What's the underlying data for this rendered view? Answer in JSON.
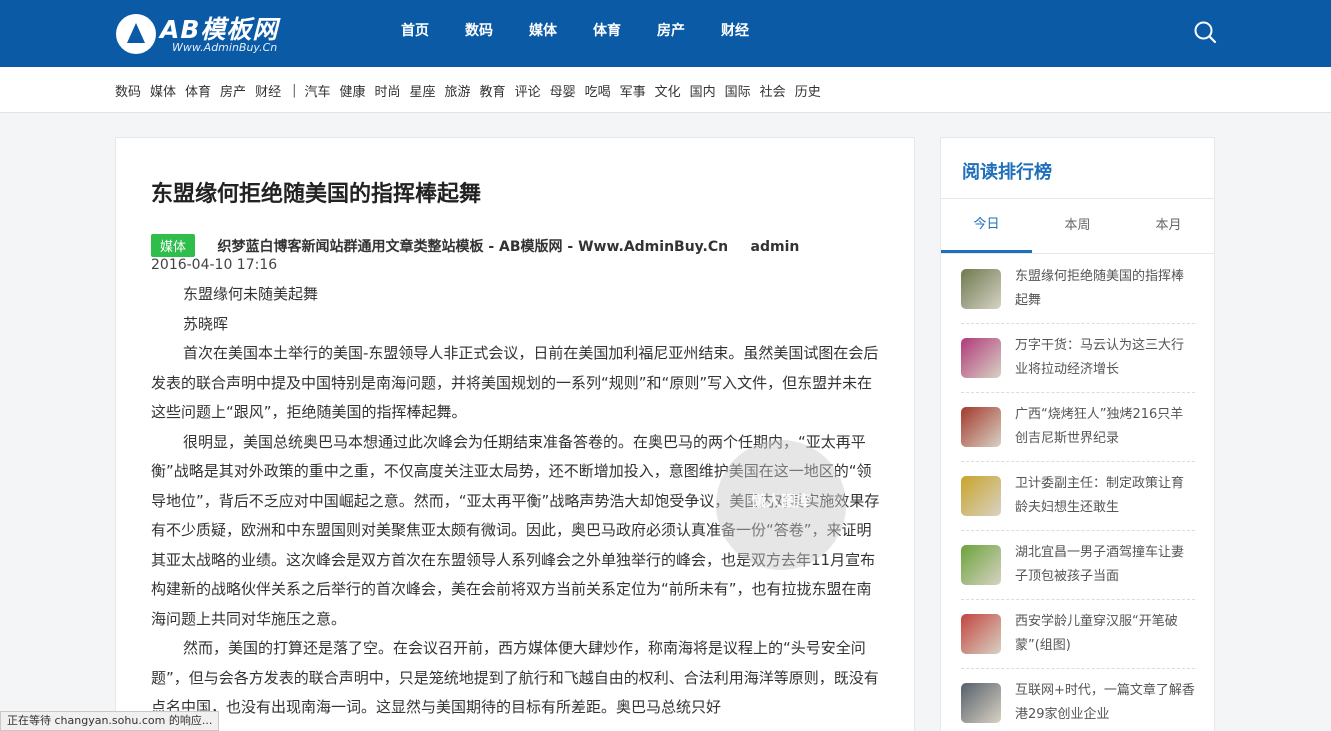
{
  "header": {
    "logo_text": "AB模板网",
    "logo_sub": "Www.AdminBuy.Cn",
    "nav": [
      "首页",
      "数码",
      "媒体",
      "体育",
      "房产",
      "财经"
    ]
  },
  "subnav": {
    "group1": [
      "数码",
      "媒体",
      "体育",
      "房产",
      "财经"
    ],
    "separator": "|",
    "group2": [
      "汽车",
      "健康",
      "时尚",
      "星座",
      "旅游",
      "教育",
      "评论",
      "母婴",
      "吃喝",
      "军事",
      "文化",
      "国内",
      "国际",
      "社会",
      "历史"
    ]
  },
  "article": {
    "title": "东盟缘何拒绝随美国的指挥棒起舞",
    "tag": "媒体",
    "source": "织梦蓝白博客新闻站群通用文章类整站模板 - AB模版网 - Www.AdminBuy.Cn",
    "author": "admin",
    "date": "2016-04-10 17:16",
    "paragraphs": [
      "东盟缘何未随美起舞",
      "苏晓晖",
      "首次在美国本土举行的美国-东盟领导人非正式会议，日前在美国加利福尼亚州结束。虽然美国试图在会后发表的联合声明中提及中国特别是南海问题，并将美国规划的一系列“规则”和“原则”写入文件，但东盟并未在这些问题上“跟风”，拒绝随美国的指挥棒起舞。",
      "很明显，美国总统奥巴马本想通过此次峰会为任期结束准备答卷的。在奥巴马的两个任期内，“亚太再平衡”战略是其对外政策的重中之重，不仅高度关注亚太局势，还不断增加投入，意图维护美国在这一地区的“领导地位”，背后不乏应对中国崛起之意。然而，“亚太再平衡”战略声势浩大却饱受争议，美国内对其实施效果存有不少质疑，欧洲和中东盟国则对美聚焦亚太颇有微词。因此，奥巴马政府必须认真准备一份“答卷”，来证明其亚太战略的业绩。这次峰会是双方首次在东盟领导人系列峰会之外单独举行的峰会，也是双方去年11月宣布构建新的战略伙伴关系之后举行的首次峰会，美在会前将双方当前关系定位为“前所未有”，也有拉拢东盟在南海问题上共同对华施压之意。",
      "然而，美国的打算还是落了空。在会议召开前，西方媒体便大肆炒作，称南海将是议程上的“头号安全问题”，但与会各方发表的联合声明中，只是笼统地提到了航行和飞越自由的权利、合法利用海洋等原则，既没有点名中国，也没有出现南海一词。这显然与美国期待的目标有所差距。奥巴马总统只好"
    ]
  },
  "sidebar": {
    "title": "阅读排行榜",
    "tabs": [
      "今日",
      "本周",
      "本月"
    ],
    "items": [
      {
        "text": "东盟缘何拒绝随美国的指挥棒起舞",
        "color": "#6d7a4f"
      },
      {
        "text": "万字干货：马云认为这三大行业将拉动经济增长",
        "color": "#b03a7a"
      },
      {
        "text": "广西“烧烤狂人”独烤216只羊创吉尼斯世界纪录",
        "color": "#a33a2e"
      },
      {
        "text": "卫计委副主任：制定政策让育龄夫妇想生还敢生",
        "color": "#c9a42a"
      },
      {
        "text": "湖北宜昌一男子酒驾撞车让妻子顶包被孩子当面",
        "color": "#6aa33a"
      },
      {
        "text": "西安学龄儿童穿汉服“开笔破蒙”(组图)",
        "color": "#c2453f"
      },
      {
        "text": "互联网+时代，一篇文章了解香港29家创业企业",
        "color": "#56606a"
      }
    ]
  },
  "watermark": "懒人图库",
  "status_text": "正在等待 changyan.sohu.com 的响应..."
}
